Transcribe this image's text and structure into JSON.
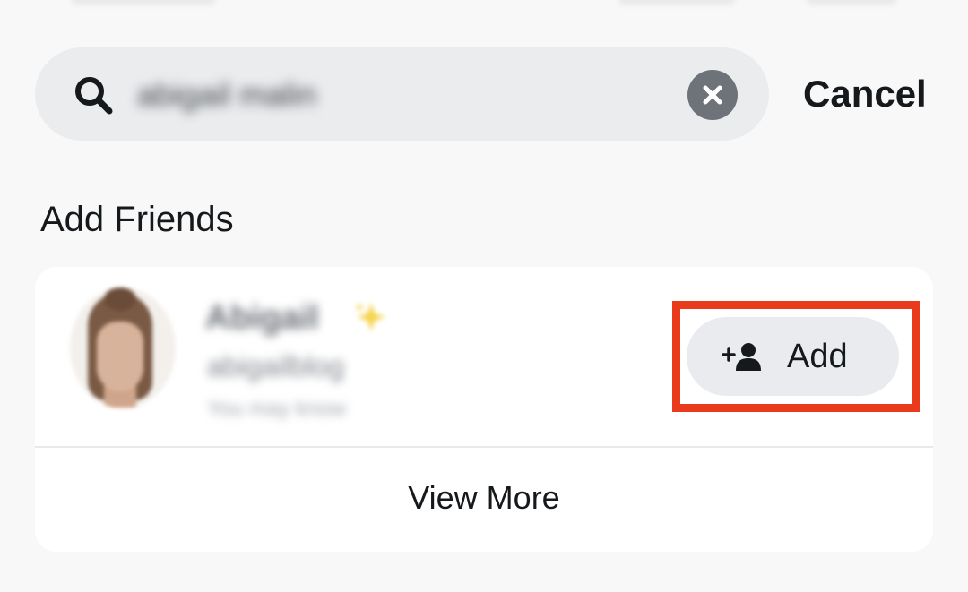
{
  "search": {
    "query": "abigail malin",
    "cancel_label": "Cancel"
  },
  "section": {
    "title": "Add Friends"
  },
  "result": {
    "display_name": "Abigail",
    "username": "abigailblog",
    "subtitle": "You may know",
    "add_label": "Add"
  },
  "footer": {
    "view_more_label": "View More"
  },
  "colors": {
    "highlight": "#ea3a1c",
    "button_bg": "#eaebee",
    "search_bg": "#ebecee",
    "clear_bg": "#6e737a"
  },
  "icons": {
    "search": "search-icon",
    "clear": "close-circle-icon",
    "add_friend": "add-friend-icon",
    "badge": "sparkle-icon"
  }
}
